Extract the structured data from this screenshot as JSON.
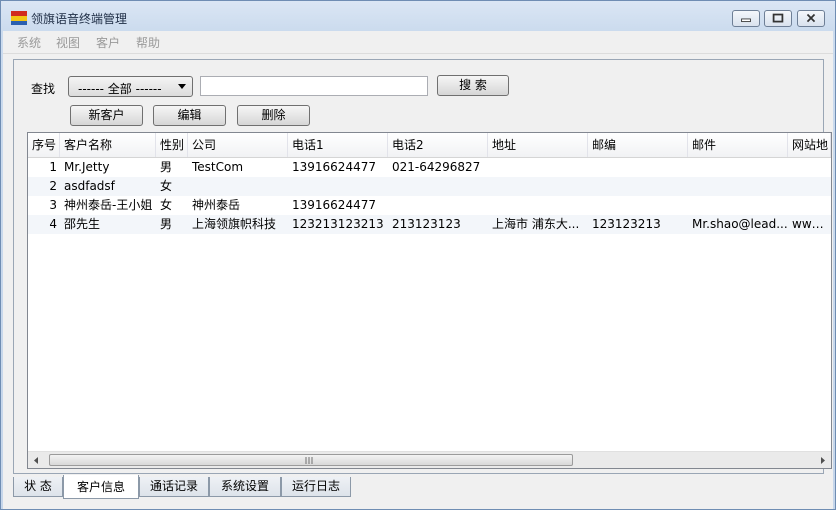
{
  "window": {
    "title": "领旗语音终端管理"
  },
  "menu": [
    "系统",
    "视图",
    "客户",
    "帮助"
  ],
  "search": {
    "label": "查找",
    "filter_value": "------ 全部 ------",
    "input_value": "",
    "button_label": "搜 索"
  },
  "actions": {
    "new_label": "新客户",
    "edit_label": "编辑",
    "delete_label": "删除"
  },
  "table": {
    "columns": [
      "序号",
      "客户名称",
      "性别",
      "公司",
      "电话1",
      "电话2",
      "地址",
      "邮编",
      "邮件",
      "网站地"
    ],
    "rows": [
      [
        "1",
        "Mr.Jetty",
        "男",
        "TestCom",
        "13916624477",
        "021-64296827",
        "",
        "",
        "",
        ""
      ],
      [
        "2",
        "asdfadsf",
        "女",
        "",
        "",
        "",
        "",
        "",
        "",
        ""
      ],
      [
        "3",
        "神州泰岳-王小姐",
        "女",
        "神州泰岳",
        "13916624477",
        "",
        "",
        "",
        "",
        ""
      ],
      [
        "4",
        "邵先生",
        "男",
        "上海领旗帜科技",
        "123213123213",
        "213123123",
        "上海市 浦东大...",
        "123123213",
        "Mr.shao@lead...",
        "www.le"
      ]
    ]
  },
  "tabs": [
    "状 态",
    "客户信息",
    "通话记录",
    "系统设置",
    "运行日志"
  ],
  "active_tab": "客户信息"
}
